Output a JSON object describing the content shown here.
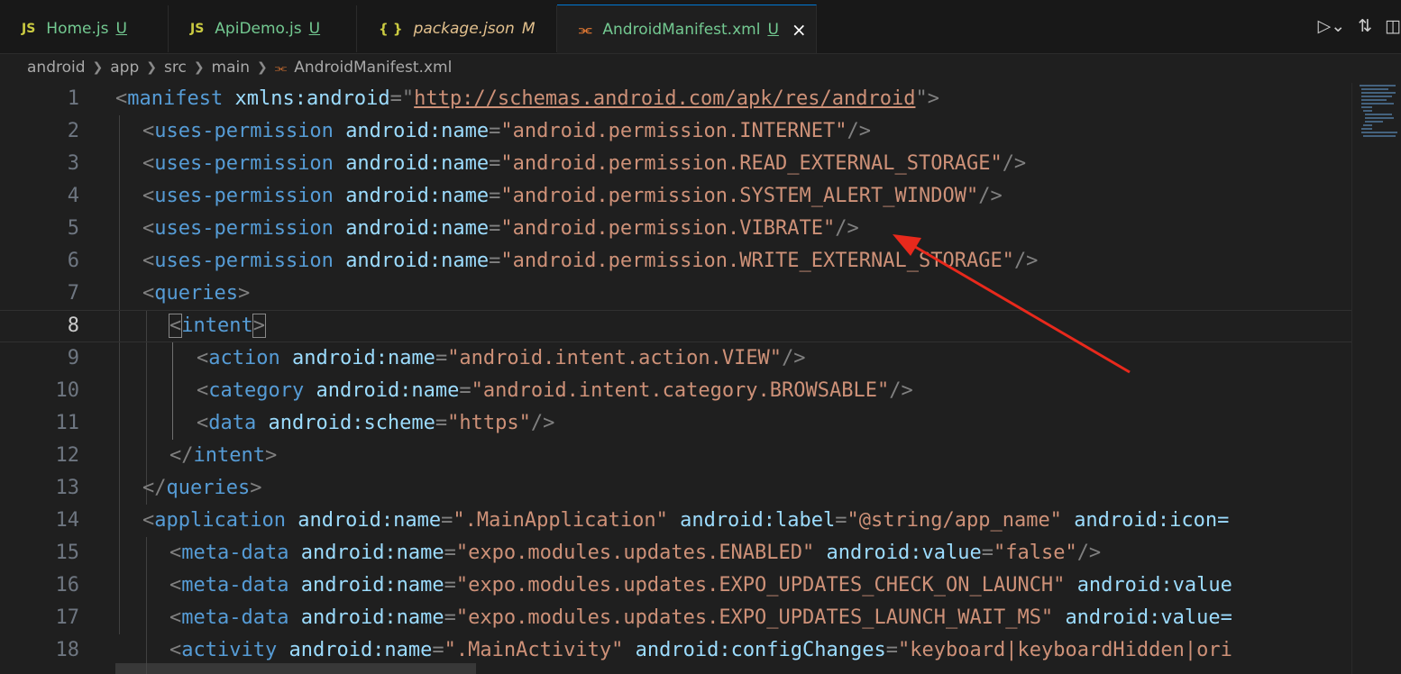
{
  "tabs": [
    {
      "icon": "JS",
      "name": "Home.js",
      "status": "U"
    },
    {
      "icon": "JS",
      "name": "ApiDemo.js",
      "status": "U"
    },
    {
      "icon": "{ }",
      "name": "package.json",
      "status": "M"
    },
    {
      "icon": "rss",
      "name": "AndroidManifest.xml",
      "status": "U",
      "close": "×"
    }
  ],
  "breadcrumb": [
    "android",
    "app",
    "src",
    "main",
    "AndroidManifest.xml"
  ],
  "line_numbers": [
    "1",
    "2",
    "3",
    "4",
    "5",
    "6",
    "7",
    "8",
    "9",
    "10",
    "11",
    "12",
    "13",
    "14",
    "15",
    "16",
    "17",
    "18"
  ],
  "code": {
    "l1": [
      "<",
      "manifest",
      " ",
      "xmlns:android",
      "=",
      "\"",
      "http://schemas.android.com/apk/res/android",
      "\"",
      ">"
    ],
    "l2": [
      "<",
      "uses-permission",
      " ",
      "android:name",
      "=",
      "\"android.permission.INTERNET\"",
      "/>"
    ],
    "l3": [
      "<",
      "uses-permission",
      " ",
      "android:name",
      "=",
      "\"android.permission.READ_EXTERNAL_STORAGE\"",
      "/>"
    ],
    "l4": [
      "<",
      "uses-permission",
      " ",
      "android:name",
      "=",
      "\"android.permission.SYSTEM_ALERT_WINDOW\"",
      "/>"
    ],
    "l5": [
      "<",
      "uses-permission",
      " ",
      "android:name",
      "=",
      "\"android.permission.VIBRATE\"",
      "/>"
    ],
    "l6": [
      "<",
      "uses-permission",
      " ",
      "android:name",
      "=",
      "\"android.permission.WRITE_EXTERNAL_STORAGE\"",
      "/>"
    ],
    "l7": [
      "<",
      "queries",
      ">"
    ],
    "l8": [
      "<",
      "intent",
      ">"
    ],
    "l9": [
      "<",
      "action",
      " ",
      "android:name",
      "=",
      "\"android.intent.action.VIEW\"",
      "/>"
    ],
    "l10": [
      "<",
      "category",
      " ",
      "android:name",
      "=",
      "\"android.intent.category.BROWSABLE\"",
      "/>"
    ],
    "l11": [
      "<",
      "data",
      " ",
      "android:scheme",
      "=",
      "\"https\"",
      "/>"
    ],
    "l12": [
      "</",
      "intent",
      ">"
    ],
    "l13": [
      "</",
      "queries",
      ">"
    ],
    "l14": [
      "<",
      "application",
      " ",
      "android:name",
      "=",
      "\".MainApplication\"",
      " ",
      "android:label",
      "=",
      "\"@string/app_name\"",
      " ",
      "android:icon="
    ],
    "l15": [
      "<",
      "meta-data",
      " ",
      "android:name",
      "=",
      "\"expo.modules.updates.ENABLED\"",
      " ",
      "android:value",
      "=",
      "\"false\"",
      "/>"
    ],
    "l16": [
      "<",
      "meta-data",
      " ",
      "android:name",
      "=",
      "\"expo.modules.updates.EXPO_UPDATES_CHECK_ON_LAUNCH\"",
      " ",
      "android:value"
    ],
    "l17": [
      "<",
      "meta-data",
      " ",
      "android:name",
      "=",
      "\"expo.modules.updates.EXPO_UPDATES_LAUNCH_WAIT_MS\"",
      " ",
      "android:value="
    ],
    "l18": [
      "<",
      "activity",
      " ",
      "android:name",
      "=",
      "\".MainActivity\"",
      " ",
      "android:configChanges",
      "=",
      "\"keyboard|keyboardHidden|ori"
    ]
  },
  "colors": {
    "tag": "#569cd6",
    "attribute": "#9cdcfe",
    "string": "#ce9178",
    "punctuation": "#808080",
    "annotation_arrow": "#e8291c"
  }
}
